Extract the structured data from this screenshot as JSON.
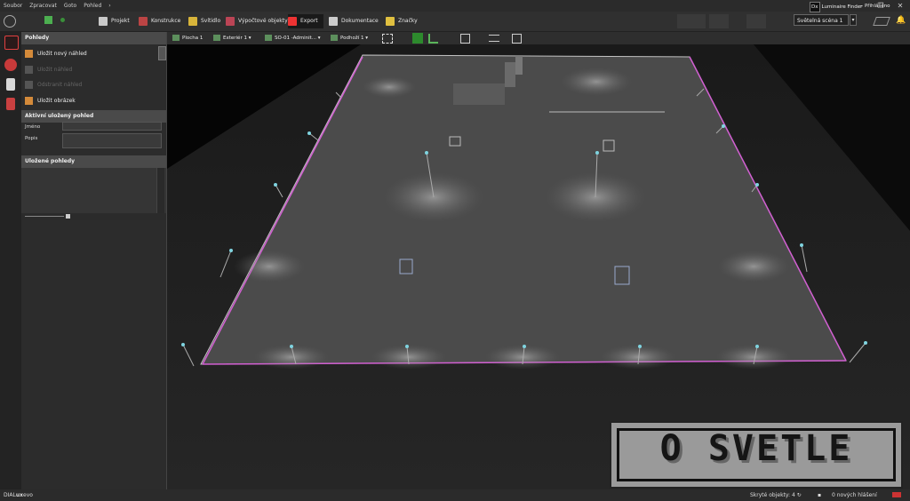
{
  "menu": [
    "Soubor",
    "Zpracovat",
    "Goto",
    "Pohled"
  ],
  "menu_more_icon": "chevron-right-icon",
  "window_controls": [
    "–",
    "❐",
    "✕"
  ],
  "toolbar": {
    "buttons": [
      {
        "label": "Projekt",
        "icon": "project-icon"
      },
      {
        "label": "Konstrukce",
        "icon": "construction-icon"
      },
      {
        "label": "Svítidlo",
        "icon": "luminaire-icon"
      },
      {
        "label": "Výpočtové objekty",
        "icon": "calc-objects-icon"
      },
      {
        "label": "Export",
        "icon": "export-icon"
      },
      {
        "label": "Dokumentace",
        "icon": "documentation-icon"
      },
      {
        "label": "Značky",
        "icon": "marks-icon"
      }
    ],
    "right": {
      "light_scene": "Světelná scéna 1",
      "luminaire_finder": "Luminaire Finder",
      "logged_in": "Přihlášeno",
      "luminaire_finder_badge": "Dx"
    }
  },
  "panel": {
    "title": "Pohledy",
    "items": [
      {
        "label": "Uložit nový náhled",
        "disabled": false
      },
      {
        "label": "Uložit náhled",
        "disabled": true
      },
      {
        "label": "Odstranit náhled",
        "disabled": true
      },
      {
        "label": "Uložit obrázek",
        "disabled": false
      }
    ],
    "active_section": "Aktivní uložený pohled",
    "name_label": "Jméno",
    "desc_label": "Popis",
    "saved_section": "Uložené pohledy"
  },
  "view_tabs": [
    {
      "label": "Plocha 1"
    },
    {
      "label": "Exteriér 1"
    },
    {
      "label": "SO-01 -Adminit..."
    },
    {
      "label": "Podhoží 1"
    }
  ],
  "status": {
    "app_name_prefix": "DIAL",
    "app_name_bold": "ux",
    "app_name_suffix": "evo",
    "hidden_objects": "Skryté objekty: 4",
    "messages": "0 nových hlášení"
  },
  "watermark": "O SVETLE",
  "colors": {
    "accent_pink": "#d15fd1",
    "toolbar_bg": "#303030",
    "panel_header": "#4a4a4a"
  }
}
